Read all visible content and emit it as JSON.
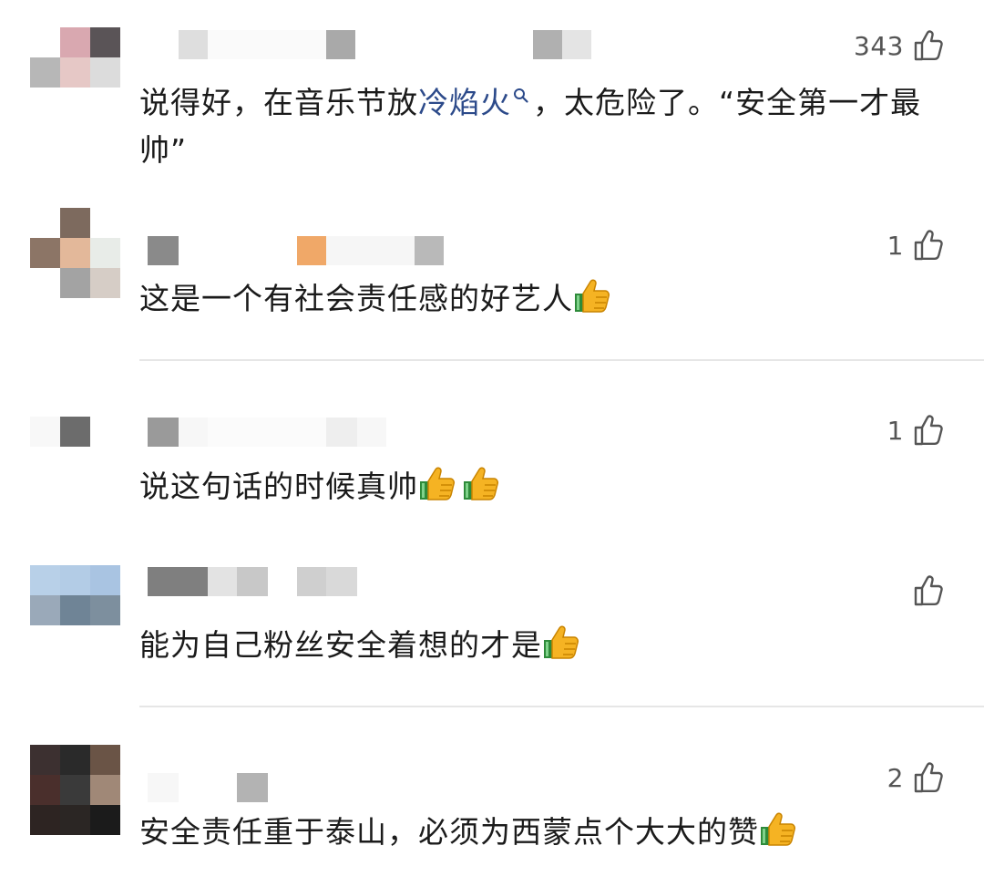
{
  "colors": {
    "link": "#2c4a8a",
    "text": "#1b1b1b",
    "meta": "#555555",
    "divider": "#e6e6e6"
  },
  "comments": [
    {
      "like_count": "343",
      "text_before_link": "说得好，在音乐节放",
      "link_text": "冷焰火",
      "link_icon": "search-icon",
      "text_after_link": "，太危险了。“安全第一才最帅”"
    },
    {
      "like_count": "1",
      "text": "这是一个有社会责任感的好艺人",
      "emoji": [
        "thumbs-up-emoji"
      ]
    },
    {
      "like_count": "1",
      "text": "说这句话的时候真帅",
      "emoji": [
        "thumbs-up-emoji",
        "thumbs-up-emoji"
      ]
    },
    {
      "like_count": "",
      "text": "能为自己粉丝安全着想的才是",
      "emoji": [
        "thumbs-up-emoji"
      ]
    },
    {
      "like_count": "2",
      "text": "安全责任重于泰山，必须为西蒙点个大大的赞",
      "emoji": [
        "thumbs-up-emoji"
      ]
    }
  ],
  "icons": {
    "like": "thumbs-up-outline-icon",
    "search": "search-icon",
    "emoji": "thumbs-up-emoji"
  }
}
